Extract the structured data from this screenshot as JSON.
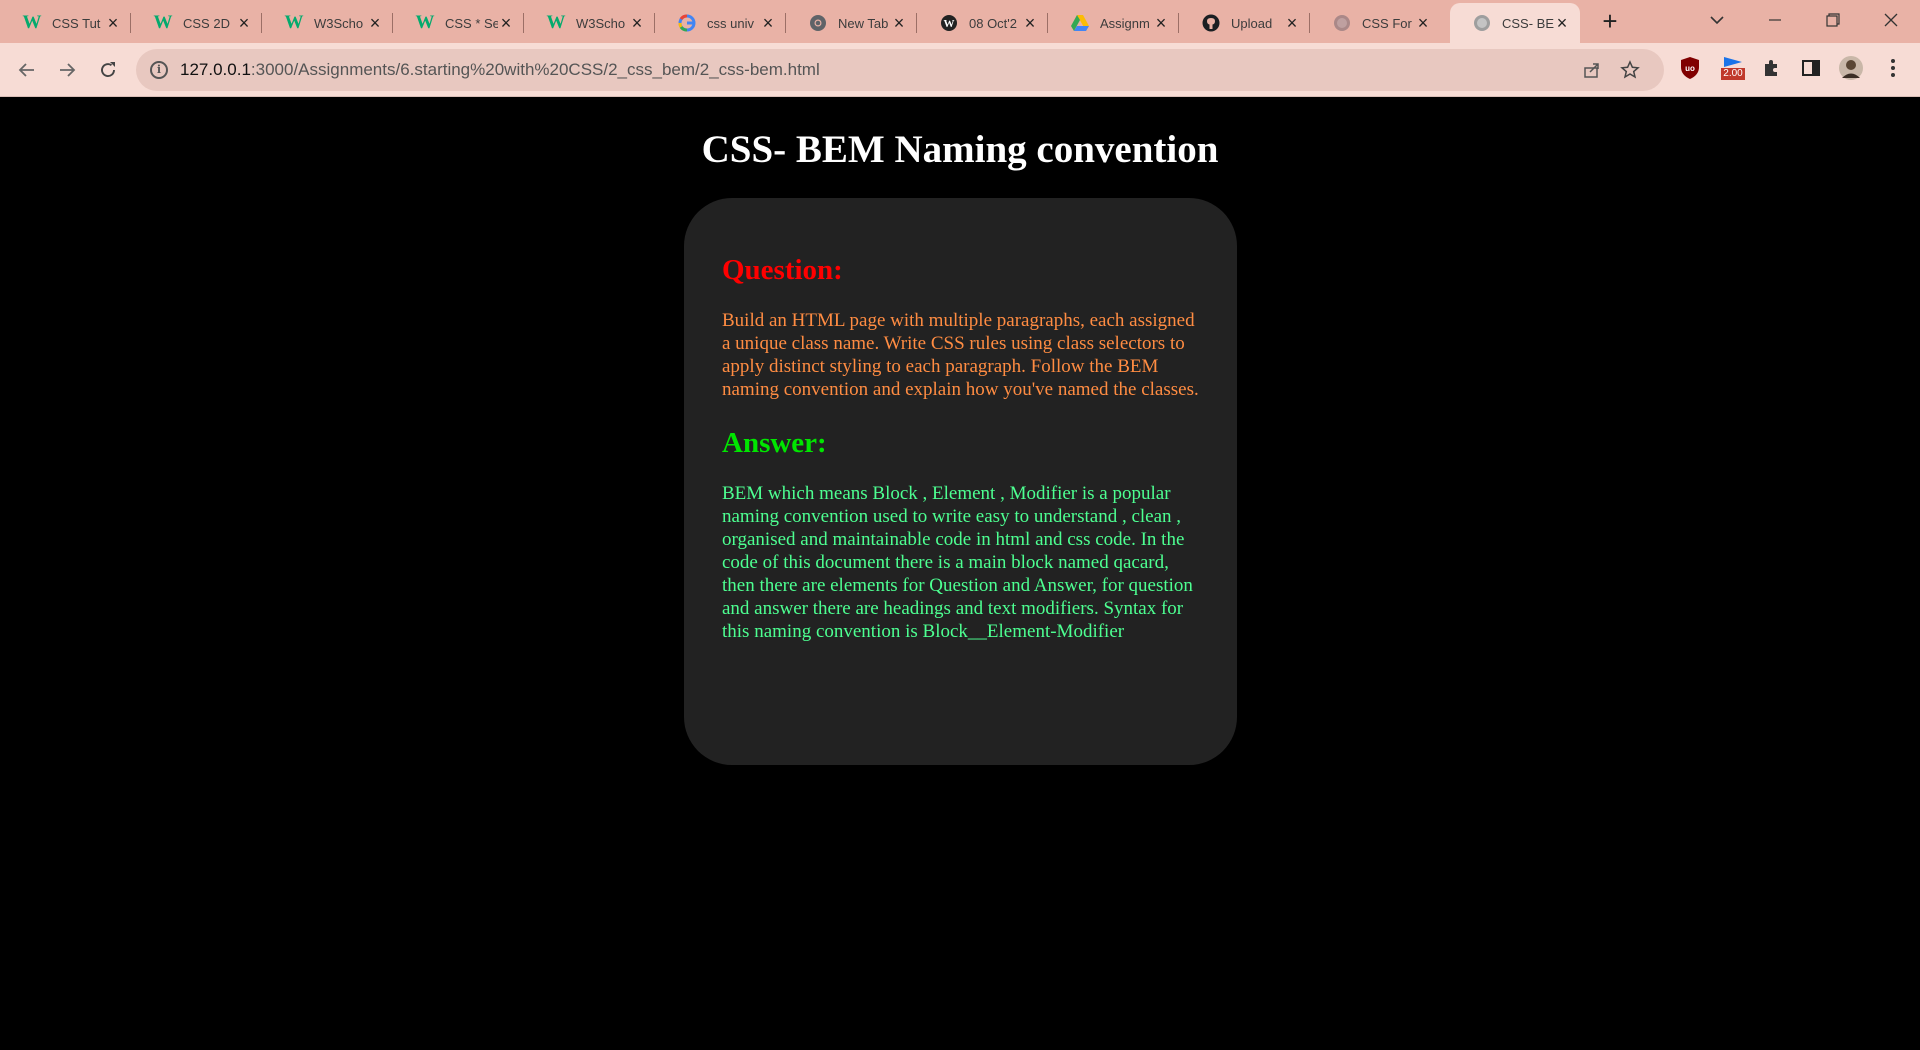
{
  "browser": {
    "tabs": [
      {
        "title": "CSS Tut",
        "icon": "w3schools-icon",
        "active": false
      },
      {
        "title": "CSS 2D",
        "icon": "w3schools-icon",
        "active": false
      },
      {
        "title": "W3Scho",
        "icon": "w3schools-icon",
        "active": false
      },
      {
        "title": "CSS * Se",
        "icon": "w3schools-icon",
        "active": false
      },
      {
        "title": "W3Scho",
        "icon": "w3schools-icon",
        "active": false
      },
      {
        "title": "css univ",
        "icon": "google-icon",
        "active": false
      },
      {
        "title": "New Tab",
        "icon": "chrome-icon",
        "active": false
      },
      {
        "title": "08 Oct'2",
        "icon": "wordpress-icon",
        "active": false
      },
      {
        "title": "Assignm",
        "icon": "google-drive-icon",
        "active": false
      },
      {
        "title": "Upload",
        "icon": "github-icon",
        "active": false
      },
      {
        "title": "CSS For",
        "icon": "globe-icon",
        "active": false
      },
      {
        "title": "CSS- BE",
        "icon": "globe-icon",
        "active": true
      }
    ],
    "address": {
      "host": "127.0.0.1",
      "path": ":3000/Assignments/6.starting%20with%20CSS/2_css_bem/2_css-bem.html"
    },
    "extension_badge": "2.00"
  },
  "page": {
    "heading": "CSS- BEM Naming convention",
    "question": {
      "heading": "Question:",
      "text": "Build an HTML page with multiple paragraphs, each assigned a unique class name. Write CSS rules using class selectors to apply distinct styling to each paragraph. Follow the BEM naming convention and explain how you've named the classes."
    },
    "answer": {
      "heading": "Answer:",
      "text": "BEM which means Block , Element , Modifier is a popular naming convention used to write easy to understand , clean , organised and maintainable code in html and css code. In the code of this document there is a main block named qacard, then there are elements for Question and Answer, for question and answer there are headings and text modifiers. Syntax for this naming convention is Block__Element-Modifier"
    }
  },
  "colors": {
    "tabstrip": "#e9b2a6",
    "toolbar": "#f7dcd5",
    "page_bg": "#000000",
    "card_bg": "#222222",
    "question_heading": "#ff0000",
    "question_text": "#ff8c42",
    "answer_heading": "#00e600",
    "answer_text": "#4dff91"
  }
}
